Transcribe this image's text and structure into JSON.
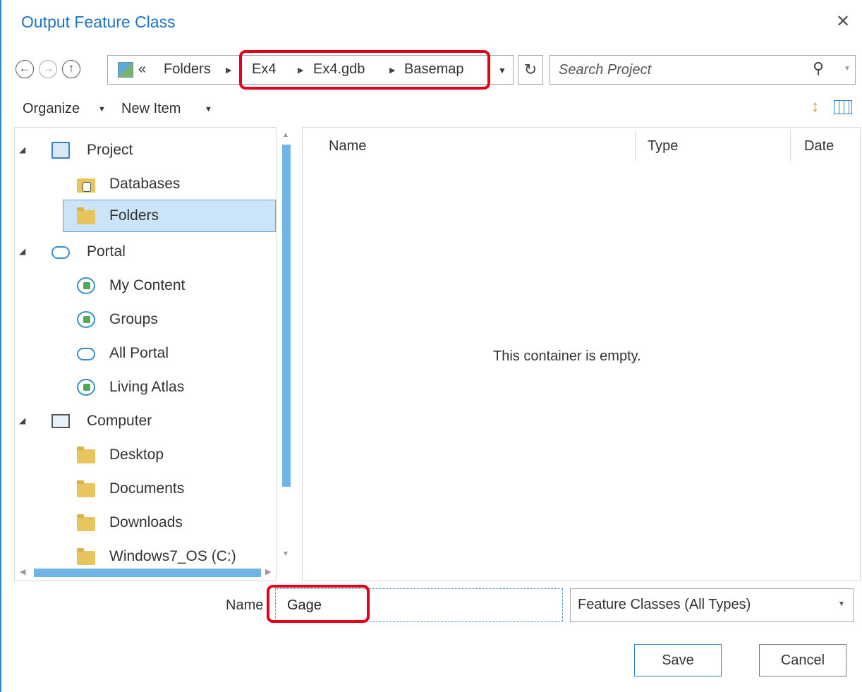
{
  "dialog": {
    "title": "Output Feature Class",
    "close": "✕"
  },
  "nav": {
    "back_icon": "←",
    "forward_icon": "→",
    "up_icon": "↑",
    "overflow": "«",
    "breadcrumbs": [
      "Folders",
      "Ex4",
      "Ex4.gdb",
      "Basemap"
    ],
    "separator": "▶",
    "dropdown": "▼",
    "refresh_icon": "↻"
  },
  "search": {
    "placeholder": "Search Project",
    "icon": "⚲",
    "dropdown": "▼"
  },
  "toolbar": {
    "organize": "Organize",
    "new_item": "New Item",
    "arrow": "▼",
    "sort_icon": "↕"
  },
  "tree": {
    "expander": "◢",
    "items": [
      {
        "label": "Project"
      },
      {
        "label": "Databases"
      },
      {
        "label": "Folders"
      },
      {
        "label": "Portal"
      },
      {
        "label": "My Content"
      },
      {
        "label": "Groups"
      },
      {
        "label": "All Portal"
      },
      {
        "label": "Living Atlas"
      },
      {
        "label": "Computer"
      },
      {
        "label": "Desktop"
      },
      {
        "label": "Documents"
      },
      {
        "label": "Downloads"
      },
      {
        "label": "Windows7_OS (C:)"
      }
    ]
  },
  "scroll": {
    "up": "▲",
    "down": "▼",
    "left": "◀",
    "right": "▶"
  },
  "content": {
    "columns": [
      "Name",
      "Type",
      "Date"
    ],
    "empty_message": "This container is empty."
  },
  "footer": {
    "name_label": "Name",
    "name_value": "Gage",
    "type_value": "Feature Classes (All Types)",
    "type_arrow": "▼",
    "save": "Save",
    "cancel": "Cancel"
  },
  "colors": {
    "accent": "#2e84c6",
    "highlight": "#e3001b",
    "selection": "#cce4f7",
    "scrollbar": "#6fb5e6"
  }
}
